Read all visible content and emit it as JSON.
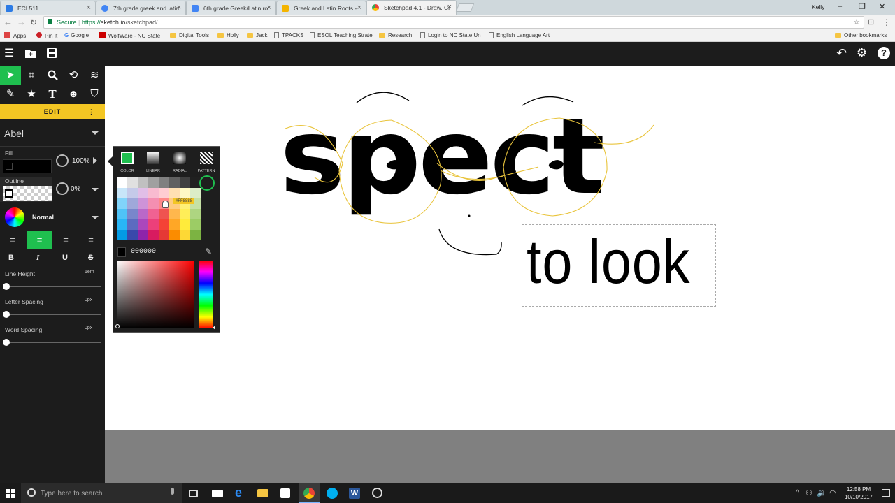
{
  "browser": {
    "tabs": [
      {
        "title": "ECI 511",
        "icon_color": "#2c7be5"
      },
      {
        "title": "7th grade greek and latin",
        "icon_color": "#4285f4"
      },
      {
        "title": "6th grade Greek/Latin ro",
        "icon_color": "#4285f4"
      },
      {
        "title": "Greek and Latin Roots -",
        "icon_color": "#f4b400"
      },
      {
        "title": "Sketchpad 4.1 - Draw, Cr",
        "icon_color": "#ea4335"
      }
    ],
    "user": "Kelly",
    "secure_label": "Secure",
    "url_scheme": "https://",
    "url_host": "sketch.io",
    "url_path": "/sketchpad/",
    "bookmarks": [
      "Apps",
      "Pin It",
      "Google",
      "WolfWare - NC State",
      "Digital Tools",
      "Holly",
      "Jack",
      "TPACKS",
      "ESOL Teaching Strate",
      "Research",
      "Login to NC State Un",
      "English Language Art"
    ],
    "other_bookmarks": "Other bookmarks"
  },
  "sidebar": {
    "edit_label": "EDIT",
    "font_name": "Abel",
    "fill_label": "Fill",
    "fill_opacity": "100%",
    "outline_label": "Outline",
    "outline_opacity": "0%",
    "blend_mode": "Normal",
    "line_height_label": "Line Height",
    "line_height_value": "1em",
    "letter_spacing_label": "Letter Spacing",
    "letter_spacing_value": "0px",
    "word_spacing_label": "Word Spacing",
    "word_spacing_value": "0px"
  },
  "palette": {
    "tabs": [
      "COLOR",
      "LINEAR",
      "RADIAL",
      "PATTERN"
    ],
    "hex_value": "000000",
    "hover_tooltip": "#FF8888"
  },
  "canvas": {
    "main_word": "spect",
    "sub_text": "to look"
  },
  "taskbar": {
    "search_placeholder": "Type here to search",
    "time": "12:58 PM",
    "date": "10/10/2017"
  }
}
